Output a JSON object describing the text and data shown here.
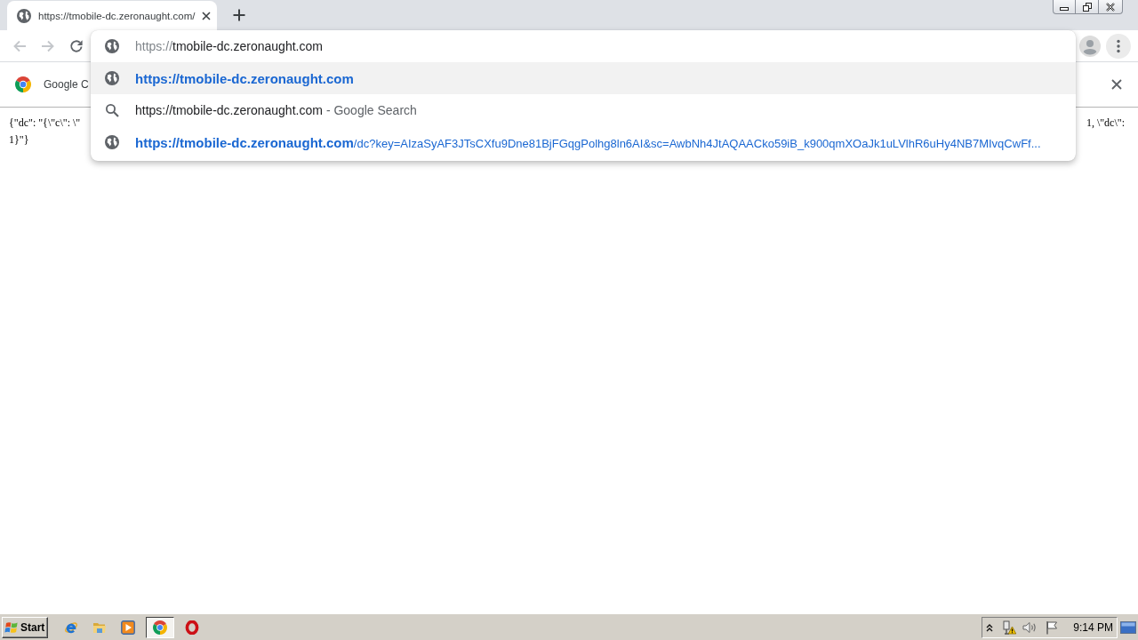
{
  "tabs": [
    {
      "title": "https://tmobile-dc.zeronaught.com/",
      "selected": true
    }
  ],
  "toolbar": {
    "nav_buttons": [
      {
        "kind": "back",
        "disabled": true
      },
      {
        "kind": "forward",
        "disabled": true
      },
      {
        "kind": "reload",
        "disabled": false
      }
    ]
  },
  "omnibox": {
    "scheme": "https://",
    "host": "tmobile-dc.zeronaught.com",
    "suggestions": [
      {
        "kind": "url",
        "selected": true,
        "text": "https://tmobile-dc.zeronaught.com"
      },
      {
        "kind": "search",
        "selected": false,
        "text": "https://tmobile-dc.zeronaught.com",
        "description": "- Google Search"
      },
      {
        "kind": "url",
        "selected": false,
        "text": "https://tmobile-dc.zeronaught.com",
        "path": "/dc?key=AIzaSyAF3JTsCXfu9Dne81BjFGqgPolhg8ln6AI&sc=AwbNh4JtAQAACko59iB_k900qmXOaJk1uLVlhR6uHy4NB7MIvqCwFf..."
      }
    ]
  },
  "infobar": {
    "text": "Google C"
  },
  "page_text": {
    "line_1_start": "{\"dc\": \"{\\\"c\\\": \\\"",
    "line_1_end": "1, \\\"dc\\\":",
    "line_2": "1}\"}"
  },
  "taskbar": {
    "start_label": "Start",
    "apps": [
      {
        "kind": "e-ring",
        "selected": false
      },
      {
        "kind": "folder",
        "selected": false
      },
      {
        "kind": "player",
        "selected": false
      },
      {
        "kind": "ring-logo",
        "selected": true
      },
      {
        "kind": "o-ring",
        "selected": false
      }
    ],
    "clock": "9:14 PM"
  }
}
